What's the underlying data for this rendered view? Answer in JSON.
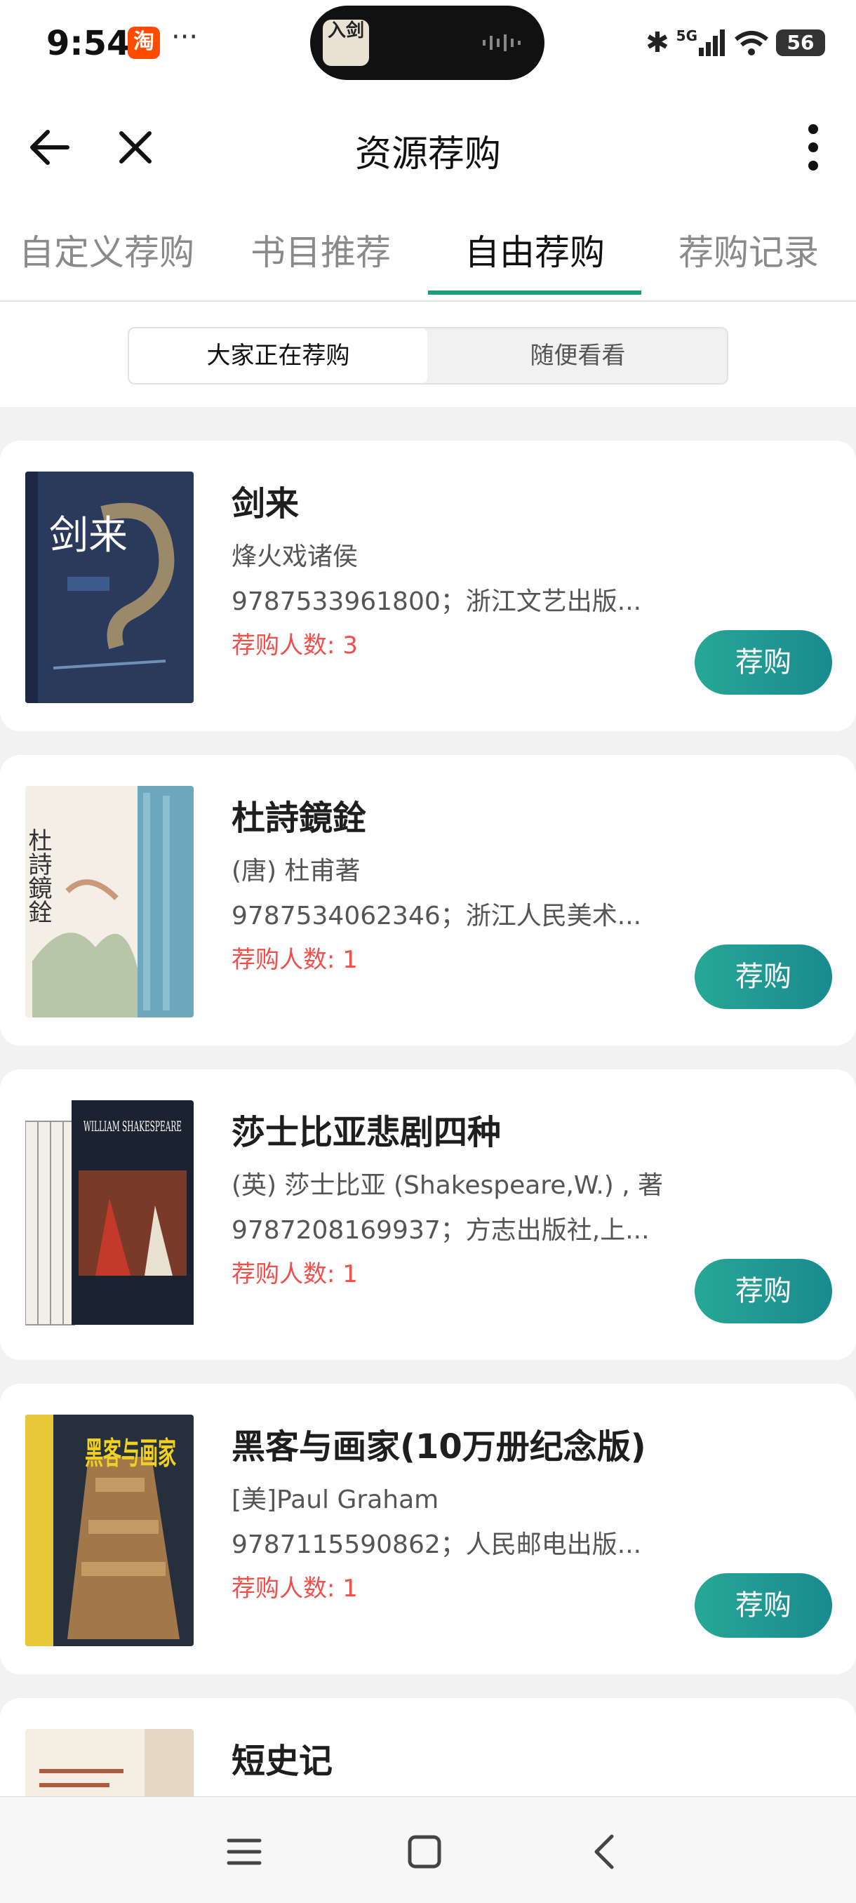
{
  "status_bar": {
    "time": "9:54",
    "app_badge": "淘",
    "dots": "···",
    "island_text": "入剑",
    "network": "5G",
    "battery": "56",
    "icons": [
      "taobao-icon",
      "bluetooth-icon",
      "signal-icon",
      "wifi-icon",
      "battery-icon"
    ]
  },
  "nav": {
    "title": "资源荐购",
    "icons": [
      "back-arrow-icon",
      "close-icon",
      "more-vertical-icon"
    ]
  },
  "tabs": [
    {
      "label": "自定义荐购",
      "active": false
    },
    {
      "label": "书目推荐",
      "active": false
    },
    {
      "label": "自由荐购",
      "active": true
    },
    {
      "label": "荐购记录",
      "active": false
    }
  ],
  "segment": {
    "options": [
      "大家正在荐购",
      "随便看看"
    ],
    "selected": "大家正在荐购"
  },
  "books": [
    {
      "title": "剑来",
      "author": "烽火戏诸侯",
      "isbn_publisher": "9787533961800；浙江文艺出版...",
      "count": "荐购人数: 3",
      "button": "荐购",
      "cover_text": "剑来"
    },
    {
      "title": "杜詩鏡銓",
      "author": "(唐) 杜甫著",
      "isbn_publisher": "9787534062346；浙江人民美术...",
      "count": "荐购人数: 1",
      "button": "荐购",
      "cover_text": "杜詩鏡銓"
    },
    {
      "title": "莎士比亚悲剧四种",
      "author": "(英) 莎士比亚 (Shakespeare,W.) , 著",
      "isbn_publisher": "9787208169937；方志出版社,上...",
      "count": "荐购人数: 1",
      "button": "荐购",
      "cover_text": "WILLIAM SHAKESPEARE"
    },
    {
      "title": "黑客与画家(10万册纪念版)",
      "author": "[美]Paul Graham",
      "isbn_publisher": "9787115590862；人民邮电出版...",
      "count": "荐购人数: 1",
      "button": "荐购",
      "cover_text": "黑客与画家"
    },
    {
      "title": "短史记",
      "author": "",
      "isbn_publisher": "",
      "count": "",
      "button": "",
      "cover_text": ""
    }
  ],
  "system_nav": {
    "icons": [
      "menu-icon",
      "home-square-icon",
      "back-chevron-icon"
    ]
  },
  "colors": {
    "accent": "#1a9e78",
    "button_start": "#26a896",
    "button_end": "#1a8a8e",
    "count_red": "#f04f4a"
  }
}
